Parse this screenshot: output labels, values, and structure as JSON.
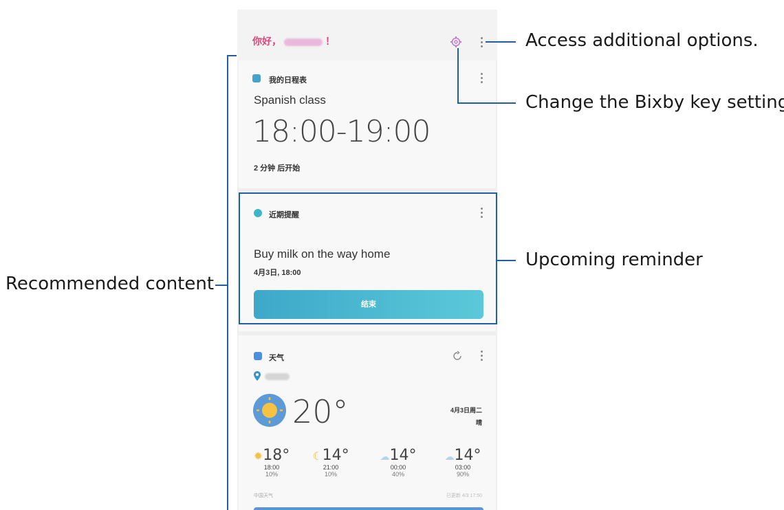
{
  "header": {
    "greeting_prefix": "你好，",
    "greeting_suffix": "！"
  },
  "schedule_card": {
    "title": "我的日程表",
    "event": "Spanish class",
    "time": "18:00-19:00",
    "status": "2 分钟 后开始"
  },
  "reminder_card": {
    "title": "近期提醒",
    "text": "Buy milk on the way home",
    "datetime": "4月3日, 18:00",
    "button": "结束"
  },
  "weather_card": {
    "title": "天气",
    "temperature": "20°",
    "date": "4月3日周二",
    "condition": "晴",
    "forecast": [
      {
        "temp": "18°",
        "hour": "18:00",
        "precip": "10%",
        "icon": "sun-icon"
      },
      {
        "temp": "14°",
        "hour": "21:00",
        "precip": "10%",
        "icon": "moon-icon"
      },
      {
        "temp": "14°",
        "hour": "00:00",
        "precip": "40%",
        "icon": "cloud-icon"
      },
      {
        "temp": "14°",
        "hour": "03:00",
        "precip": "90%",
        "icon": "cloud-icon"
      }
    ],
    "provider": "中国天气",
    "updated": "已更新 4/3 17:50"
  },
  "callouts": {
    "options": "Access additional options.",
    "bixby": "Change the Bixby key setting.",
    "reminder": "Upcoming reminder",
    "recommended": "Recommended content"
  },
  "colors": {
    "accent_line": "#1f5fa6",
    "greeting": "#e0457b",
    "button": "#3da8c9"
  }
}
